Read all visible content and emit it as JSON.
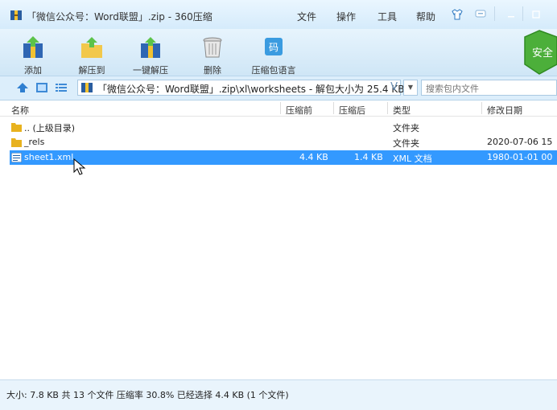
{
  "window": {
    "title": "「微信公众号：Word联盟」.zip - 360压缩",
    "menu": [
      "文件",
      "操作",
      "工具",
      "帮助"
    ]
  },
  "toolbar": {
    "add": "添加",
    "extract_to": "解压到",
    "one_click_extract": "一键解压",
    "delete": "删除",
    "comment": "压缩包语言",
    "security_badge": "安全"
  },
  "address": {
    "path": "「微信公众号：Word联盟」.zip\\xl\\worksheets - 解包大小为 25.4 KB",
    "search_placeholder": "搜索包内文件"
  },
  "columns": {
    "name": "名称",
    "compressed_before": "压缩前",
    "compressed_after": "压缩后",
    "type": "类型",
    "modified": "修改日期"
  },
  "files": [
    {
      "name": ".. (上级目录)",
      "before": "",
      "after": "",
      "type": "文件夹",
      "modified": "",
      "icon": "folder-icon",
      "selected": false
    },
    {
      "name": "_rels",
      "before": "",
      "after": "",
      "type": "文件夹",
      "modified": "2020-07-06 15",
      "icon": "folder-icon",
      "selected": false
    },
    {
      "name": "sheet1.xml",
      "before": "4.4 KB",
      "after": "1.4 KB",
      "type": "XML 文档",
      "modified": "1980-01-01 00",
      "icon": "xml-file-icon",
      "selected": true
    }
  ],
  "status": {
    "text": "大小: 7.8 KB 共 13 个文件 压缩率 30.8% 已经选择 4.4 KB (1 个文件)"
  },
  "colors": {
    "selection": "#3399ff",
    "ribbon": "#cfe6f6",
    "shield": "#4caf3a"
  }
}
